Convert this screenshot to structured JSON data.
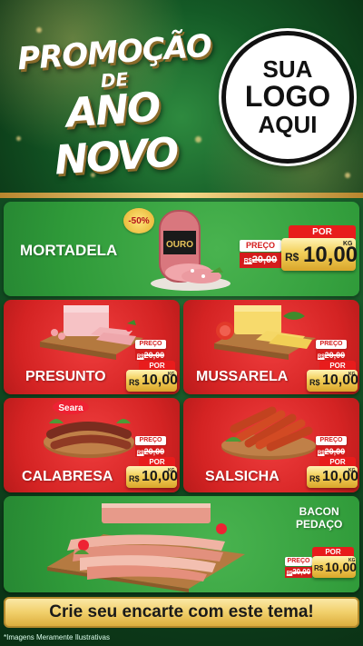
{
  "header": {
    "title_line1": "PROMOÇÃO",
    "title_line2": "DE",
    "title_line3": "ANO NOVO",
    "logo_line1": "SUA",
    "logo_line2": "LOGO",
    "logo_line3": "AQUI"
  },
  "colors": {
    "green_card": "#2f9a39",
    "red_card": "#d42323",
    "gold": "#f1cf6a"
  },
  "products": [
    {
      "name": "MORTADELA",
      "brand": "OURO",
      "discount_badge": "-50%",
      "preco_label": "PREÇO",
      "old_price": "20,00",
      "old_cur": "R$",
      "por_label": "POR",
      "currency": "R$",
      "price": "10,00",
      "unit": "KG"
    },
    {
      "name": "PRESUNTO",
      "preco_label": "PREÇO",
      "old_price": "20,00",
      "old_cur": "R$",
      "por_label": "POR",
      "currency": "R$",
      "price": "10,00",
      "unit": "KG"
    },
    {
      "name": "MUSSARELA",
      "preco_label": "PREÇO",
      "old_price": "20,00",
      "old_cur": "R$",
      "por_label": "POR",
      "currency": "R$",
      "price": "10,00",
      "unit": "KG"
    },
    {
      "name": "CALABRESA",
      "brand": "Seara",
      "preco_label": "PREÇO",
      "old_price": "20,00",
      "old_cur": "R$",
      "por_label": "POR",
      "currency": "R$",
      "price": "10,00",
      "unit": "KG"
    },
    {
      "name": "SALSICHA",
      "preco_label": "PREÇO",
      "old_price": "20,00",
      "old_cur": "R$",
      "por_label": "POR",
      "currency": "R$",
      "price": "10,00",
      "unit": "KG"
    },
    {
      "name_line1": "BACON",
      "name_line2": "PEDAÇO",
      "preco_label": "PREÇO",
      "old_price": "20,00",
      "old_cur": "R$",
      "por_label": "POR",
      "currency": "R$",
      "price": "10,00",
      "unit": "KG"
    }
  ],
  "footer": {
    "cta": "Crie seu encarte com este tema!",
    "disclaimer": "*Imagens Meramente Ilustrativas"
  }
}
